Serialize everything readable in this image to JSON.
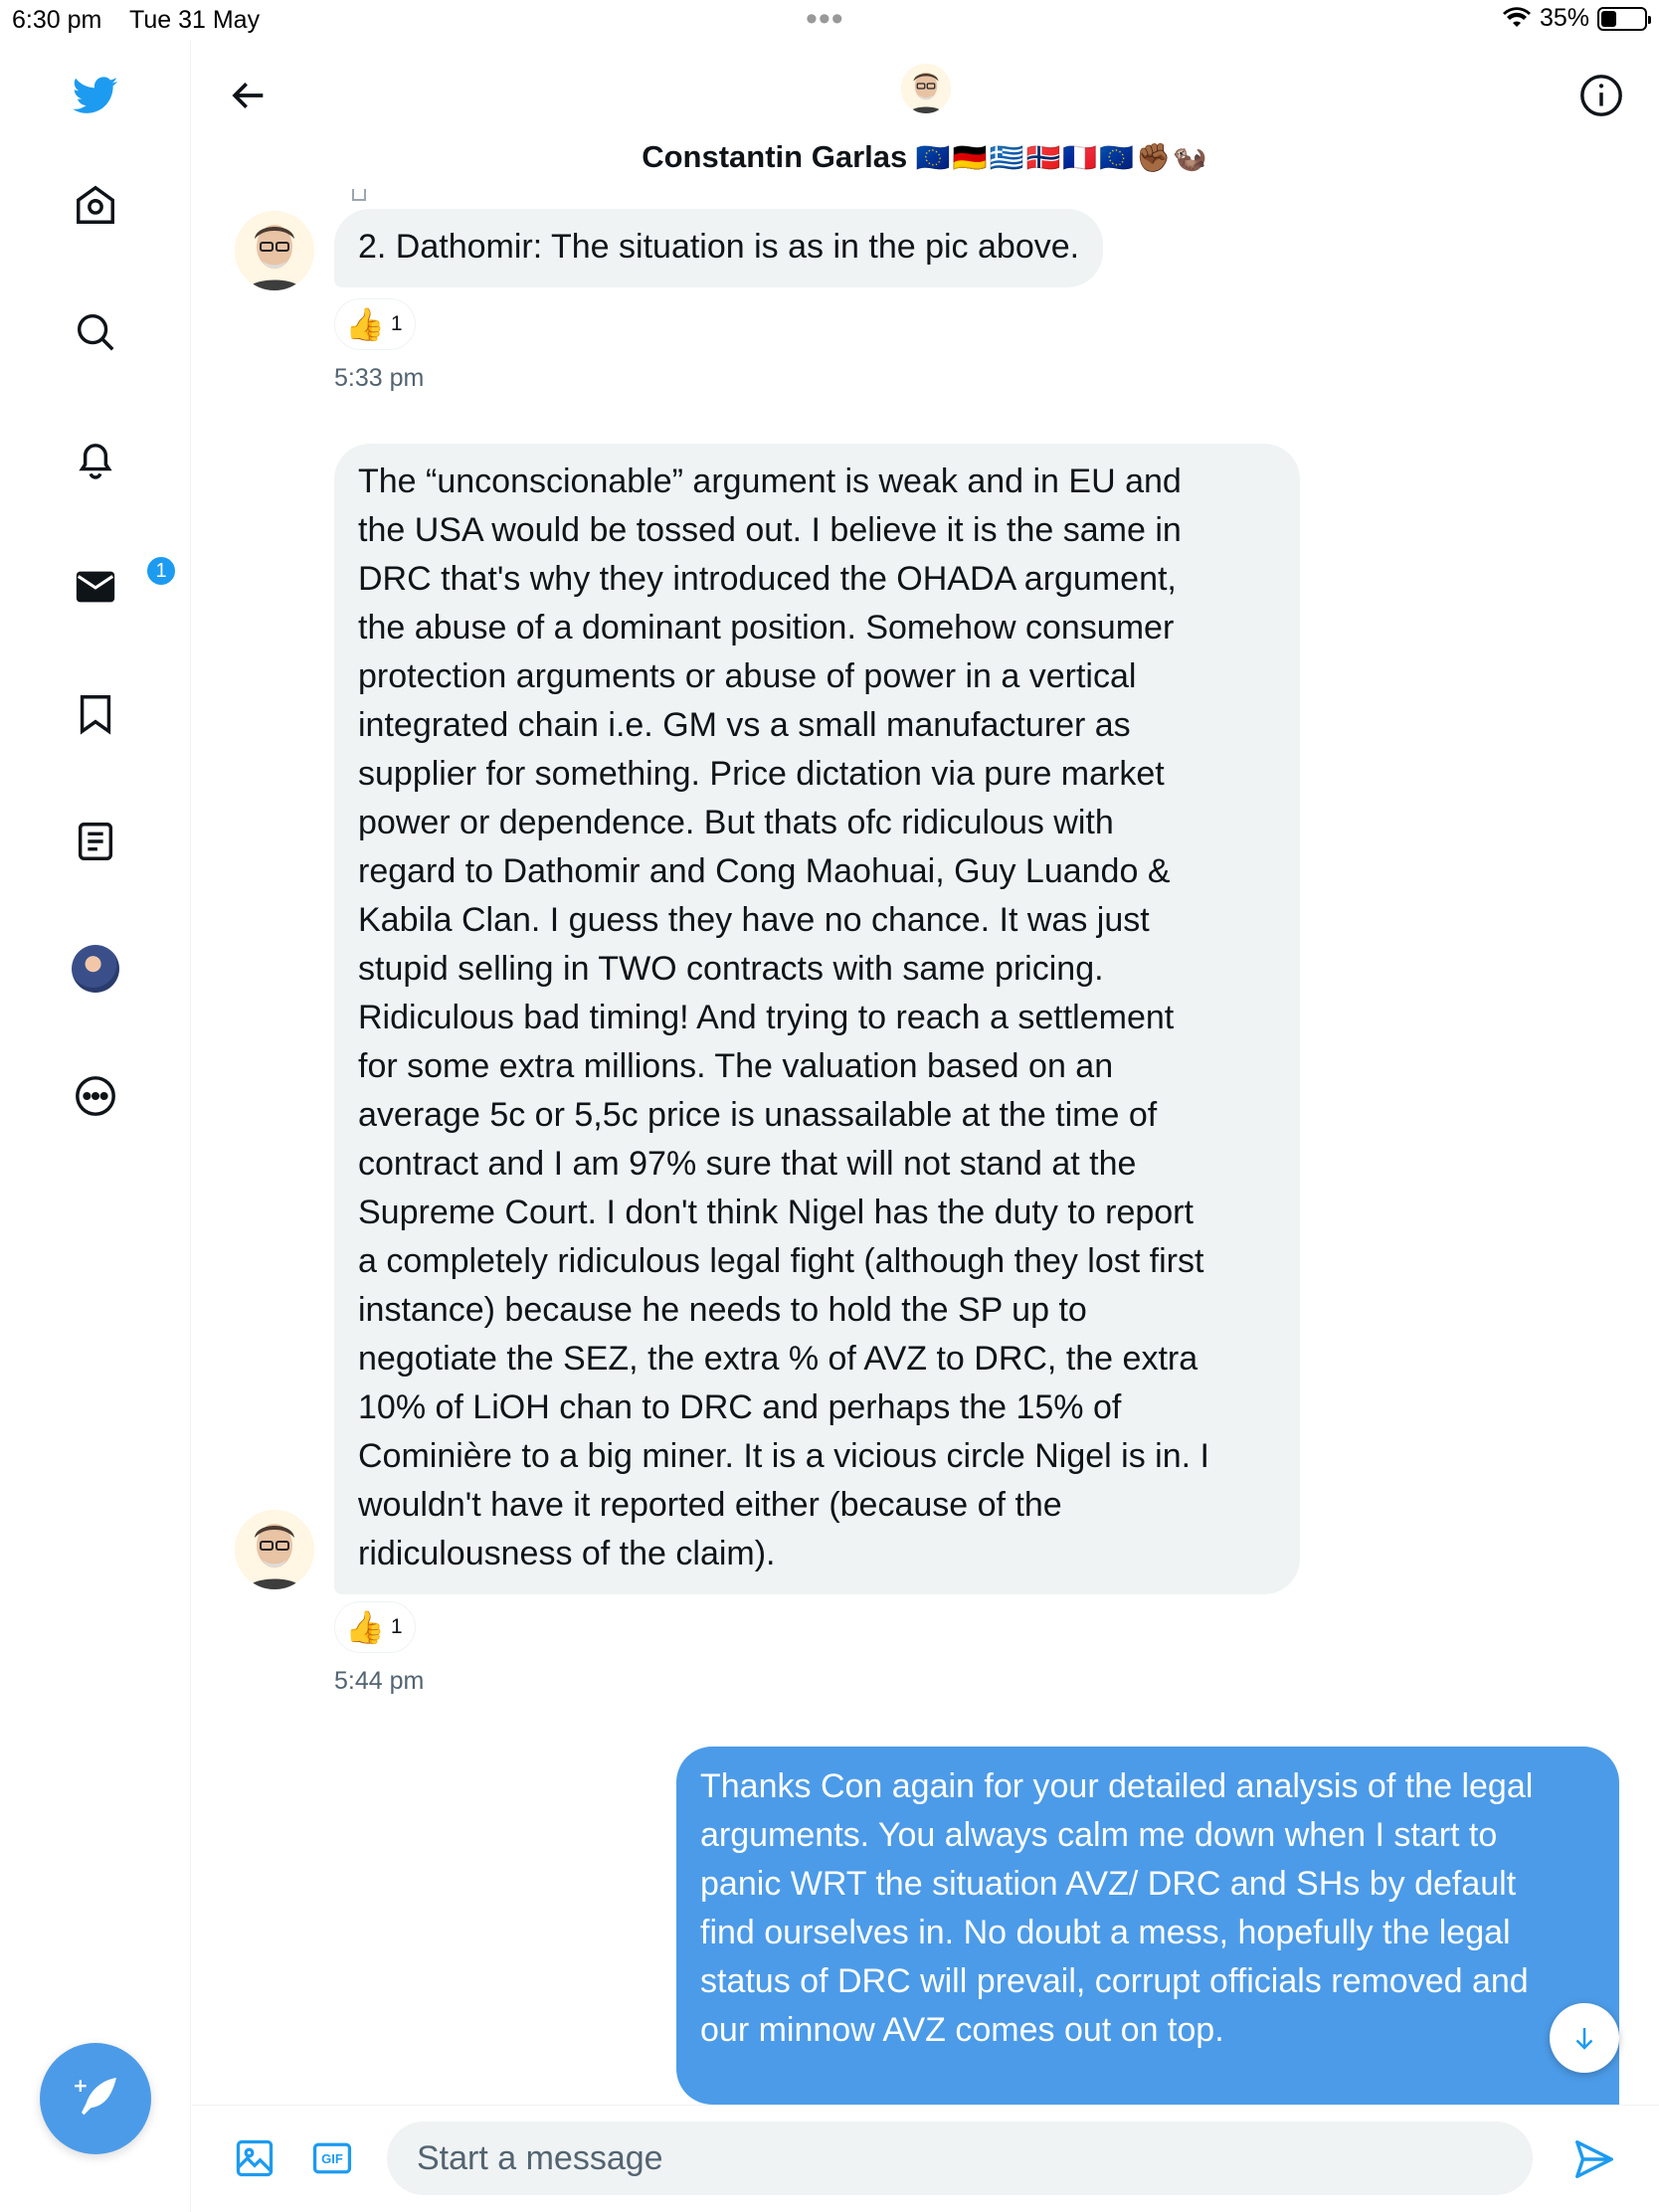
{
  "status_bar": {
    "time": "6:30 pm",
    "date": "Tue 31 May",
    "battery": "35%",
    "battery_level": 0.35
  },
  "nav": {
    "items": [
      {
        "icon": "twitter-logo-icon"
      },
      {
        "icon": "home-icon"
      },
      {
        "icon": "search-icon"
      },
      {
        "icon": "notifications-bell-icon"
      },
      {
        "icon": "messages-envelope-icon",
        "badge": "1"
      },
      {
        "icon": "bookmark-icon"
      },
      {
        "icon": "lists-icon"
      },
      {
        "icon": "profile-avatar"
      },
      {
        "icon": "more-icon"
      }
    ],
    "compose_icon": "compose-tweet-icon"
  },
  "header": {
    "name": "Constantin Garlas",
    "flags": "🇪🇺🇩🇪🇬🇷🇳🇴🇫🇷🇪🇺✊🏾🦦"
  },
  "messages": [
    {
      "direction": "in",
      "text": "2. Dathomir: The situation is as in the pic above.",
      "reaction": {
        "emoji": "👍",
        "count": "1"
      },
      "time": "5:33 pm"
    },
    {
      "direction": "in",
      "lines": [
        "The “unconscionable” argument is weak and in EU and",
        "the USA would be tossed out.  I believe it is the same in",
        "DRC that's why  they introduced the OHADA argument,",
        "the abuse of a dominant position. Somehow consumer",
        "protection arguments or abuse of power in a vertical",
        "integrated chain i.e. GM vs a small manufacturer as",
        "supplier for something. Price dictation via pure market",
        "power or dependence. But thats ofc ridiculous with",
        "regard to Dathomir and Cong Maohuai, Guy Luando &",
        "Kabila Clan. I guess they have no chance. It was just",
        "stupid selling in TWO contracts with same pricing.",
        "Ridiculous bad timing! And trying to reach a settlement",
        "for some extra millions. The valuation based on an",
        "average 5c or 5,5c price is unassailable at the time of",
        "contract and I am 97% sure that will not stand at the",
        "Supreme Court. I don't think Nigel has the duty to report",
        "a completely ridiculous legal fight (although they lost first",
        "instance) because he needs to hold the SP up to",
        "negotiate the SEZ, the extra % of AVZ to DRC, the extra",
        "10% of LiOH chan to DRC and perhaps the 15% of",
        "Cominière to a big miner. It is a vicious circle Nigel is in. I",
        "wouldn't have it reported either (because of the",
        "ridiculousness of the claim)."
      ],
      "reaction": {
        "emoji": "👍",
        "count": "1"
      },
      "time": "5:44 pm"
    },
    {
      "direction": "out",
      "lines": [
        "Thanks Con again for your detailed analysis of the legal",
        "arguments. You always calm me down when I start to",
        "panic WRT the situation AVZ/ DRC and SHs by default",
        "find ourselves in. No doubt a mess, hopefully the legal",
        "status of DRC will prevail, corrupt officials removed and",
        "our minnow AVZ comes out on top."
      ]
    }
  ],
  "composer": {
    "placeholder": "Start a message",
    "value": "",
    "image_icon": "image-icon",
    "gif_label": "GIF",
    "send_icon": "send-icon"
  },
  "colors": {
    "accent": "#1d9bf0",
    "outgoing_bubble": "#4c9be8",
    "incoming_bubble": "#eff3f4",
    "muted_text": "#536471"
  }
}
